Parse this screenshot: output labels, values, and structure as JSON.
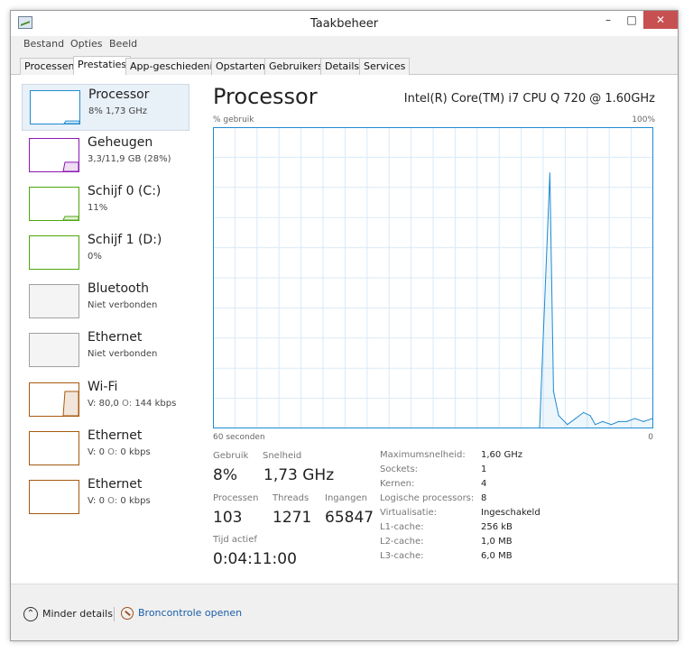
{
  "window": {
    "title": "Taakbeheer"
  },
  "menu": [
    "Bestand",
    "Opties",
    "Beeld"
  ],
  "tabs": [
    {
      "label": "Processen",
      "active": false
    },
    {
      "label": "Prestaties",
      "active": true
    },
    {
      "label": "App-geschiedenis",
      "active": false
    },
    {
      "label": "Opstarten",
      "active": false
    },
    {
      "label": "Gebruikers",
      "active": false
    },
    {
      "label": "Details",
      "active": false
    },
    {
      "label": "Services",
      "active": false
    }
  ],
  "sidebar": {
    "items": [
      {
        "name": "Processor",
        "sub": "8% 1,73 GHz",
        "color": "#1e8bd1",
        "selected": true,
        "level": 0.08
      },
      {
        "name": "Geheugen",
        "sub": "3,3/11,9 GB (28%)",
        "color": "#8b19b0",
        "selected": false,
        "level": 0.28
      },
      {
        "name": "Schijf 0 (C:)",
        "sub": "11%",
        "color": "#4da60c",
        "selected": false,
        "level": 0.11
      },
      {
        "name": "Schijf 1 (D:)",
        "sub": "0%",
        "color": "#4da60c",
        "selected": false,
        "level": 0.0
      },
      {
        "name": "Bluetooth",
        "sub": "Niet verbonden",
        "color": "#a0a0a0",
        "selected": false,
        "level": null
      },
      {
        "name": "Ethernet",
        "sub": "Niet verbonden",
        "color": "#a0a0a0",
        "selected": false,
        "level": null
      },
      {
        "name": "Wi-Fi",
        "sub_v_label": "V:",
        "sub_v": "80,0",
        "sub_o_label": "O:",
        "sub_o": "144 kbps",
        "color": "#a75a0f",
        "selected": false,
        "level": 0.75
      },
      {
        "name": "Ethernet",
        "sub_v_label": "V:",
        "sub_v": "0",
        "sub_o_label": "O:",
        "sub_o": "0 kbps",
        "color": "#a75a0f",
        "selected": false,
        "level": 0.0
      },
      {
        "name": "Ethernet",
        "sub_v_label": "V:",
        "sub_v": "0",
        "sub_o_label": "O:",
        "sub_o": "0 kbps",
        "color": "#a75a0f",
        "selected": false,
        "level": 0.0
      }
    ]
  },
  "main": {
    "title": "Processor",
    "cpu_name": "Intel(R) Core(TM) i7 CPU Q 720 @ 1.60GHz",
    "axis_top_left": "% gebruik",
    "axis_top_right": "100%",
    "axis_bottom_left": "60 seconden",
    "axis_bottom_right": "0"
  },
  "chart_data": {
    "type": "area",
    "x_range": [
      60,
      0
    ],
    "ylim": [
      0,
      100
    ],
    "grid": true,
    "color": "#1e8bd1",
    "x_seconds_ago": [
      15.4,
      14.0,
      13.5,
      12.8,
      11.6,
      10.5,
      9.4,
      8.5,
      7.8,
      6.8,
      5.6,
      4.6,
      3.5,
      2.4,
      1.2,
      0.0
    ],
    "values": [
      0,
      85,
      12,
      4,
      1,
      3,
      5,
      4,
      1,
      2,
      1,
      2,
      2,
      3,
      2,
      3
    ]
  },
  "stats": {
    "gebruik_label": "Gebruik",
    "gebruik_value": "8%",
    "snelheid_label": "Snelheid",
    "snelheid_value": "1,73 GHz",
    "processen_label": "Processen",
    "processen_value": "103",
    "threads_label": "Threads",
    "threads_value": "1271",
    "ingangen_label": "Ingangen",
    "ingangen_value": "65847",
    "tijd_label": "Tijd actief",
    "tijd_value": "0:04:11:00"
  },
  "specs": [
    {
      "label": "Maximumsnelheid:",
      "value": "1,60 GHz"
    },
    {
      "label": "Sockets:",
      "value": "1"
    },
    {
      "label": "Kernen:",
      "value": "4"
    },
    {
      "label": "Logische processors:",
      "value": "8"
    },
    {
      "label": "Virtualisatie:",
      "value": "Ingeschakeld"
    },
    {
      "label": "L1-cache:",
      "value": "256 kB"
    },
    {
      "label": "L2-cache:",
      "value": "1,0 MB"
    },
    {
      "label": "L3-cache:",
      "value": "6,0 MB"
    }
  ],
  "footer": {
    "fewer_details": "Minder details",
    "open_resmon": "Broncontrole openen"
  }
}
